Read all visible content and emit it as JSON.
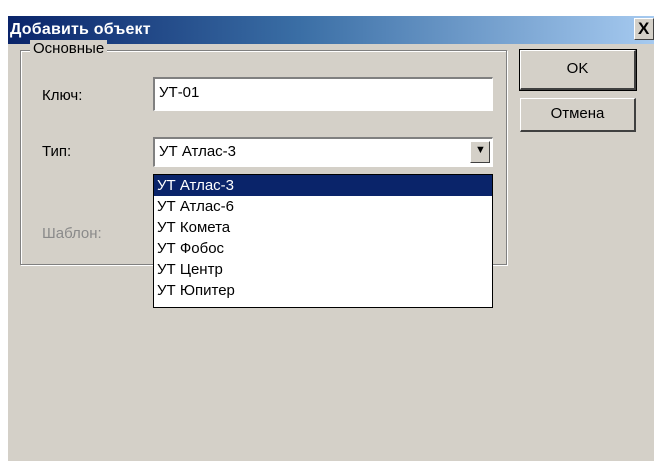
{
  "dialog": {
    "title": "Добавить объект",
    "close_symbol": "X"
  },
  "group": {
    "legend": "Основные",
    "key_label": "Ключ:",
    "key_value": "УТ-01",
    "type_label": "Тип:",
    "type_selected": "УТ Атлас-3",
    "template_label": "Шаблон:"
  },
  "dropdown": {
    "items": [
      "УТ Атлас-3",
      "УТ Атлас-6",
      "УТ Комета",
      "УТ Фобос",
      "УТ Центр",
      "УТ Юпитер"
    ],
    "highlighted_index": 0,
    "arrow_icon": "chevron-down-icon"
  },
  "buttons": {
    "ok": "OK",
    "cancel": "Отмена"
  },
  "colors": {
    "title_bar": "#0a246a",
    "selection": "#0a246a",
    "dialog_face": "#d4d0c8"
  }
}
